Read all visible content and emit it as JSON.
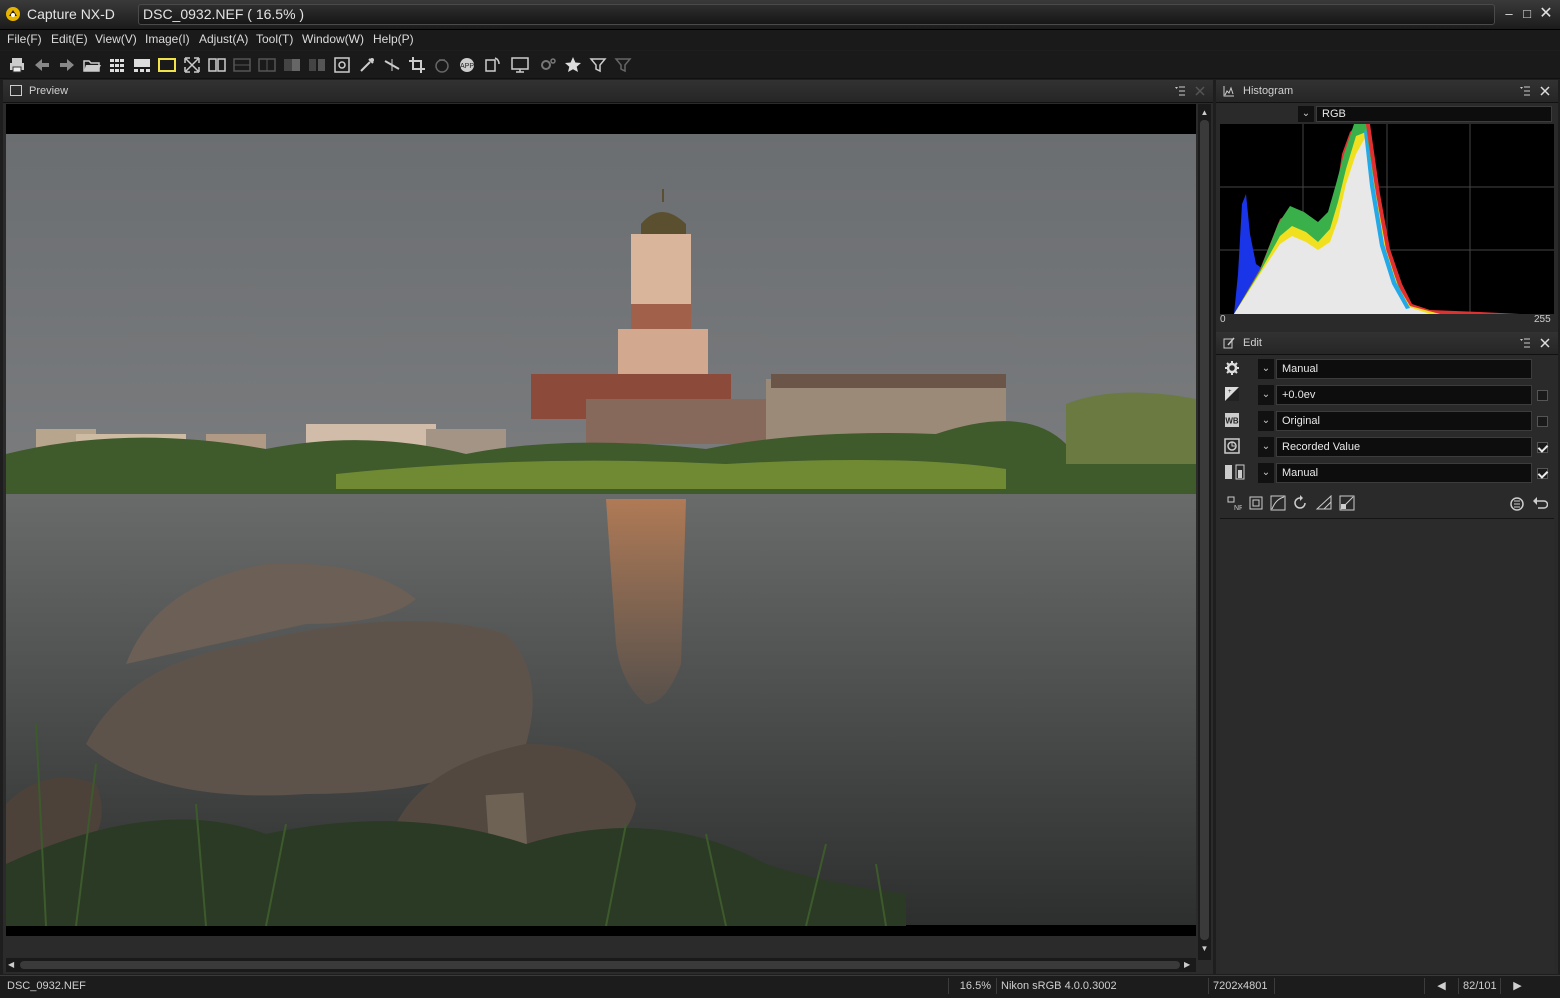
{
  "window": {
    "app_name": "Capture NX-D",
    "document_title": "DSC_0932.NEF ( 16.5% )"
  },
  "menu": {
    "items": [
      "File(F)",
      "Edit(E)",
      "View(V)",
      "Image(I)",
      "Adjust(A)",
      "Tool(T)",
      "Window(W)",
      "Help(P)"
    ]
  },
  "toolbar": {
    "icons": [
      "print-icon",
      "back-icon",
      "forward-icon",
      "open-folder-icon",
      "thumbnail-grid-icon",
      "filmstrip-icon",
      "viewer-icon",
      "full-screen-icon",
      "compare-two-icon",
      "compare-split-icon",
      "compare-before-after-icon",
      "compare-lr-icon",
      "compare-ud-icon",
      "zoom-fit-icon",
      "picker-icon",
      "straighten-icon",
      "crop-icon",
      "retouch-icon",
      "open-with-app-icon",
      "rotate-icon",
      "slideshow-icon",
      "settings-icon",
      "favorite-star-icon",
      "filter-icon",
      "filter-clear-icon"
    ]
  },
  "preview": {
    "title": "Preview"
  },
  "histogram": {
    "title": "Histogram",
    "channel": "RGB",
    "axis_min": "0",
    "axis_max": "255"
  },
  "edit": {
    "title": "Edit",
    "rows": [
      {
        "icon": "gear-icon",
        "value": "Manual",
        "checkbox": "none"
      },
      {
        "icon": "exposure-icon",
        "value": "+0.0ev",
        "checkbox": "off"
      },
      {
        "icon": "white-balance-icon",
        "value": "Original",
        "checkbox": "off"
      },
      {
        "icon": "picture-control-icon",
        "value": "Recorded Value",
        "checkbox": "on"
      },
      {
        "icon": "dlighting-icon",
        "value": "Manual",
        "checkbox": "on"
      }
    ],
    "tool_icons": [
      "noise-reduction-icon",
      "lens-correction-icon",
      "curves-icon",
      "rotate-icon",
      "perspective-icon",
      "lch-icon"
    ],
    "reset_icons": [
      "history-icon",
      "undo-icon"
    ]
  },
  "status": {
    "filename": "DSC_0932.NEF",
    "zoom": "16.5%",
    "color_profile": "Nikon sRGB 4.0.0.3002",
    "dimensions": "7202x4801",
    "position": "82/101",
    "prev_label": "◀",
    "next_label": "▶"
  },
  "colors": {
    "background": "#1e1e1e",
    "panel": "#2a2a2a",
    "highlight": "#f2e24a"
  }
}
